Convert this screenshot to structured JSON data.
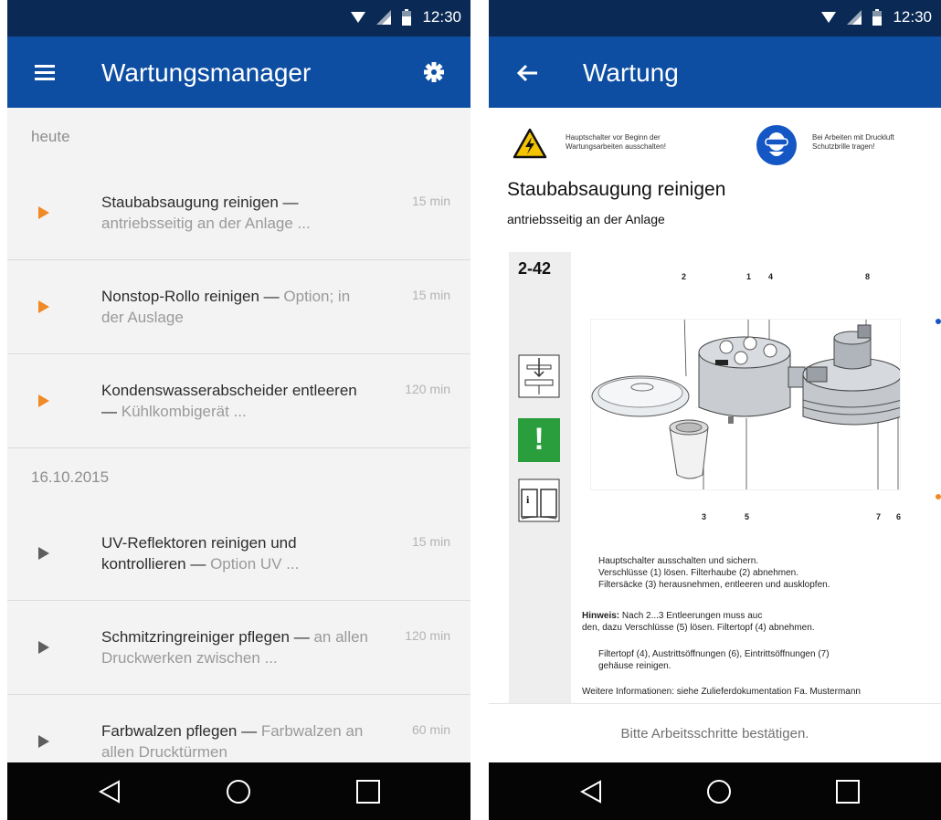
{
  "status": {
    "time": "12:30"
  },
  "left": {
    "title": "Wartungsmanager",
    "sections": [
      {
        "header": "heute",
        "items": [
          {
            "title": "Staubabsaugung reinigen",
            "detail": "antriebsseitig an der Anlage ...",
            "duration": "15 min"
          },
          {
            "title": "Nonstop-Rollo reinigen",
            "detail": "Option; in der Auslage",
            "duration": "15 min"
          },
          {
            "title": "Kondenswasserabscheider entleeren",
            "detail": "Kühlkombigerät ...",
            "duration": "120 min"
          }
        ]
      },
      {
        "header": "16.10.2015",
        "items": [
          {
            "title": "UV-Reflektoren reinigen und kontrollieren",
            "detail": "Option UV ...",
            "duration": "15 min"
          },
          {
            "title": "Schmitzringreiniger pflegen",
            "detail": "an allen Druckwerken zwischen ...",
            "duration": "120 min"
          },
          {
            "title": "Farbwalzen pflegen",
            "detail": "Farbwalzen an allen Drucktürmen",
            "duration": "60 min"
          }
        ]
      }
    ]
  },
  "right": {
    "title": "Wartung",
    "warning_1": [
      "Hauptschalter vor Beginn der",
      "Wartungsarbeiten ausschalten!"
    ],
    "warning_2": [
      "Bei Arbeiten mit Druckluft",
      "Schutzbrille tragen!"
    ],
    "task_title": "Staubabsaugung reinigen",
    "task_subtitle": "antriebsseitig an der Anlage",
    "code": "2-42",
    "callouts": [
      "2",
      "1",
      "4",
      "8",
      "3",
      "5",
      "7",
      "6"
    ],
    "steps": [
      "Hauptschalter ausschalten und sichern.",
      "Verschlüsse (1) lösen. Filterhaube (2) abnehmen.",
      "Filtersäcke (3) herausnehmen, entleeren und ausklopfen."
    ],
    "hint_label": "Hinweis:",
    "hint_text": "Nach 2...3 Entleerungen muss auc",
    "hint_line2": "den, dazu Verschlüsse (5) lösen. Filtertopf (4) abnehmen.",
    "clean_line1": "Filtertopf (4), Austrittsöffnungen (6), Eintrittsöffnungen (7)",
    "clean_line2": "gehäuse reinigen.",
    "more_info": "Weitere Informationen: siehe Zulieferdokumentation Fa. Mustermann",
    "confirm": "Bitte Arbeitsschritte bestätigen."
  },
  "colors": {
    "appbar": "#0d4ea3",
    "statusbar": "#0a2a55",
    "accent": "#f08a24",
    "ok_green": "#2a9e3c"
  },
  "icons": [
    "menu-icon",
    "gear-icon",
    "back-arrow-icon",
    "wifi-icon",
    "signal-icon",
    "battery-icon",
    "play-icon",
    "nav-back-icon",
    "nav-home-icon",
    "nav-recents-icon",
    "high-voltage-warning-icon",
    "safety-goggles-icon",
    "press-symbol-icon",
    "attention-icon",
    "manual-book-icon"
  ]
}
